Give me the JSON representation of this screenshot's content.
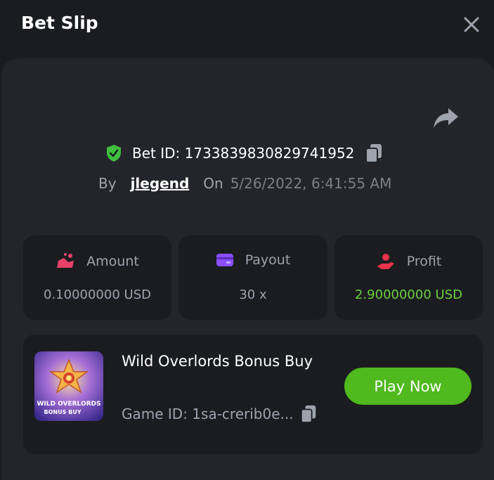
{
  "header": {
    "title": "Bet Slip"
  },
  "bet": {
    "id_label": "Bet ID: 1733839830829741952",
    "by_label": "By",
    "username": "jlegend",
    "on_label": "On",
    "date": "5/26/2022, 6:41:55 AM"
  },
  "stats": [
    {
      "label": "Amount",
      "value": "0.10000000 USD",
      "icon": "amount-icon",
      "color": "#e8426a"
    },
    {
      "label": "Payout",
      "value": "30 x",
      "icon": "wallet-icon",
      "color": "#8a4fff"
    },
    {
      "label": "Profit",
      "value": "2.90000000 USD",
      "icon": "profit-hand-icon",
      "color": "#e8334a"
    }
  ],
  "game": {
    "title": "Wild Overlords Bonus Buy",
    "id_label": "Game ID: 1sa-crerib0e...",
    "thumb_text_line1": "WILD OVERLORDS",
    "thumb_text_line2": "BONUS BUY",
    "play_label": "Play Now"
  },
  "colors": {
    "background": "#1b1c20",
    "panel": "#24252a",
    "accent_green": "#4fb91d",
    "profit_green": "#6cd141"
  }
}
